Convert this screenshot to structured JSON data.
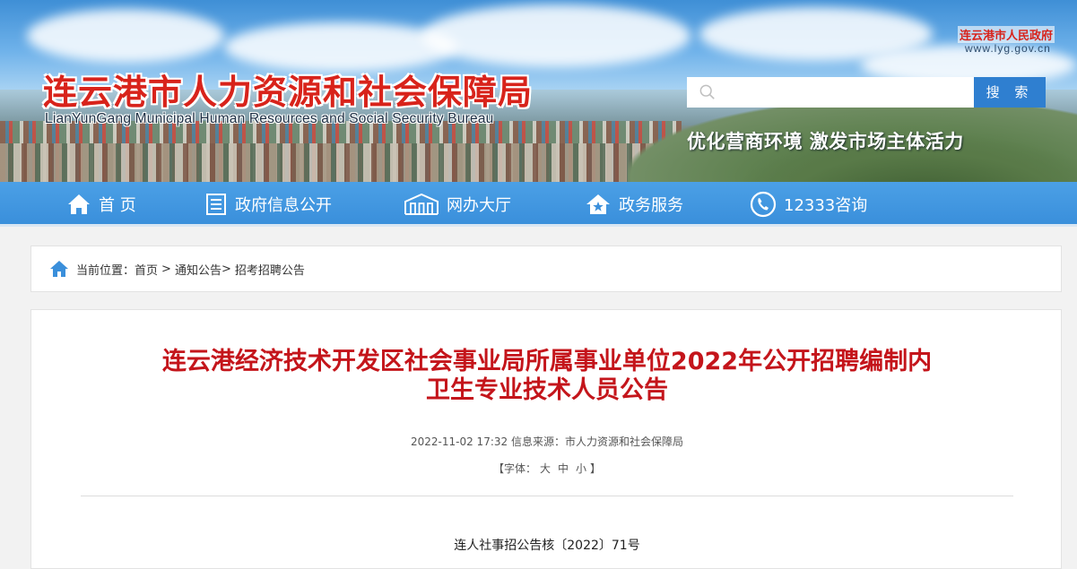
{
  "header": {
    "site_title": "连云港市人力资源和社会保障局",
    "site_subtitle": "LianYunGang Municipal Human Resources and Social Security Bureau",
    "gov_name": "连云港市人民政府",
    "gov_url": "www.lyg.gov.cn",
    "search_placeholder": "",
    "search_button": "搜 索",
    "slogan": "优化营商环境 激发市场主体活力"
  },
  "nav": {
    "items": [
      {
        "label": "首 页",
        "icon": "home-icon"
      },
      {
        "label": "政府信息公开",
        "icon": "document-icon"
      },
      {
        "label": "网办大厅",
        "icon": "building-icon"
      },
      {
        "label": "政务服务",
        "icon": "house-star-icon"
      },
      {
        "label": "12333咨询",
        "icon": "phone-icon"
      }
    ]
  },
  "breadcrumb": {
    "prefix": "当前位置：",
    "items": [
      "首页",
      "通知公告",
      "招考招聘公告"
    ],
    "separator": ">"
  },
  "article": {
    "title_line1": "连云港经济技术开发区社会事业局所属事业单位2022年公开招聘编制内",
    "title_line2": "卫生专业技术人员公告",
    "date": "2022-11-02 17:32",
    "source_label": "信息来源：",
    "source": "市人力资源和社会保障局",
    "font_size_open": "【字体：",
    "font_size_large": "大",
    "font_size_medium": "中",
    "font_size_small": "小",
    "font_size_close": "】",
    "doc_number": "连人社事招公告核〔2022〕71号"
  },
  "colors": {
    "title_red": "#c4151b",
    "nav_blue": "#3a8fdb",
    "search_blue": "#2f7fd0"
  }
}
